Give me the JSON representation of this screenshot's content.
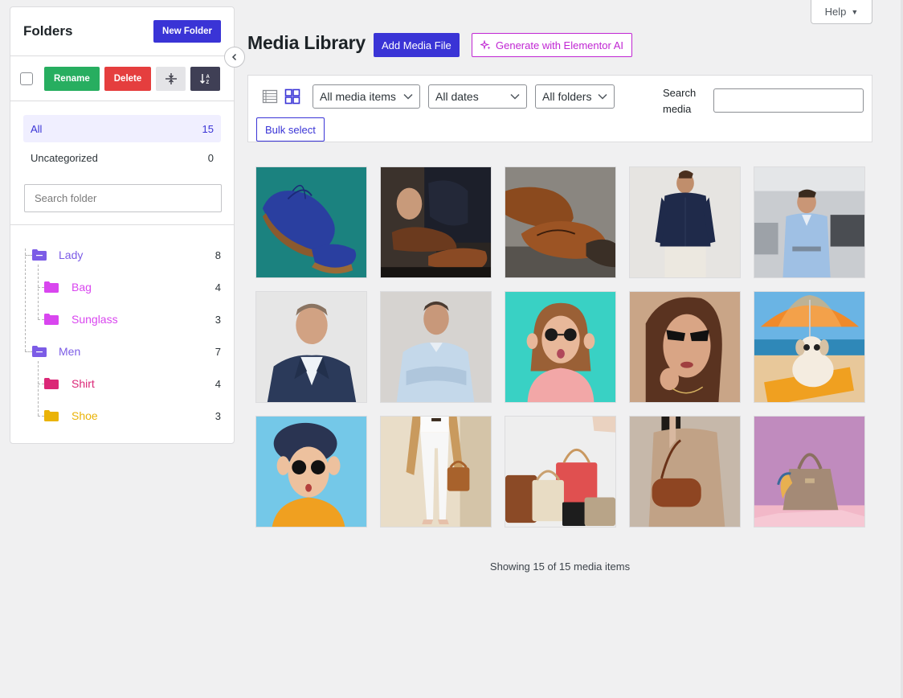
{
  "sidebar": {
    "title": "Folders",
    "new_folder_label": "New Folder",
    "rename_label": "Rename",
    "delete_label": "Delete",
    "all": {
      "label": "All",
      "count": "15"
    },
    "uncategorized": {
      "label": "Uncategorized",
      "count": "0"
    },
    "search_placeholder": "Search folder",
    "tree": [
      {
        "label": "Lady",
        "count": "8",
        "color": "#7c5ce6"
      },
      {
        "label": "Bag",
        "count": "4",
        "color": "#d946ef"
      },
      {
        "label": "Sunglass",
        "count": "3",
        "color": "#d946ef"
      },
      {
        "label": "Men",
        "count": "7",
        "color": "#7c5ce6"
      },
      {
        "label": "Shirt",
        "count": "4",
        "color": "#db2777"
      },
      {
        "label": "Shoe",
        "count": "3",
        "color": "#eab308"
      }
    ]
  },
  "header": {
    "help_label": "Help",
    "title": "Media Library",
    "add_media_label": "Add Media File",
    "ai_label": "Generate with Elementor AI"
  },
  "filters": {
    "media_type": "All media items",
    "dates": "All dates",
    "folders": "All folders",
    "search_label_line1": "Search",
    "search_label_line2": "media",
    "bulk_select_label": "Bulk select"
  },
  "media_items": [
    {
      "name": "blue-sneaker"
    },
    {
      "name": "man-loafer"
    },
    {
      "name": "brown-oxford-shoes"
    },
    {
      "name": "man-navy-shirt"
    },
    {
      "name": "man-office"
    },
    {
      "name": "man-suit"
    },
    {
      "name": "man-light-shirt"
    },
    {
      "name": "woman-sunglasses-teal"
    },
    {
      "name": "woman-black-sunglasses"
    },
    {
      "name": "dog-beach-umbrella"
    },
    {
      "name": "woman-hat-sunglasses"
    },
    {
      "name": "woman-trench-handbag"
    },
    {
      "name": "handbags-collection"
    },
    {
      "name": "woman-shoulder-bag"
    },
    {
      "name": "beige-handbag-scarf"
    }
  ],
  "footer": {
    "showing_text": "Showing 15 of 15 media items"
  },
  "colors": {
    "accent": "#3a34d6",
    "rename": "#27ae60",
    "delete": "#e53e3e",
    "ai": "#c026d3"
  }
}
